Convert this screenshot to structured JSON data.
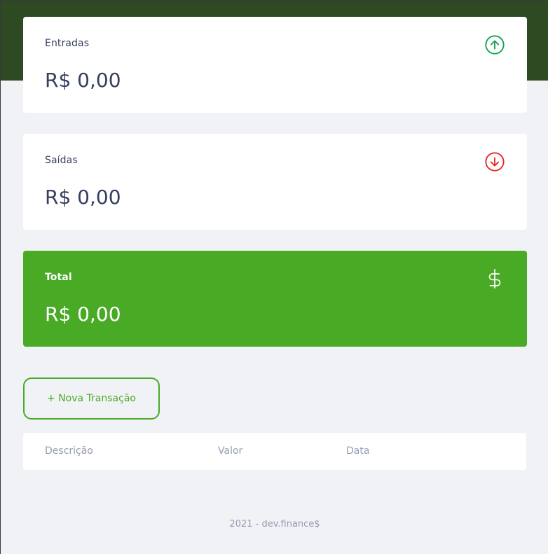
{
  "colors": {
    "header_bg": "#2d4a22",
    "page_bg": "#f0f2f5",
    "card_bg": "#ffffff",
    "total_bg": "#49aa26",
    "income_icon": "#12a454",
    "expense_icon": "#e92929",
    "text": "#363f5f",
    "muted_text": "#969cb3"
  },
  "cards": {
    "income": {
      "label": "Entradas",
      "value": "R$ 0,00",
      "icon": "arrow-up-circle-icon"
    },
    "expense": {
      "label": "Saídas",
      "value": "R$ 0,00",
      "icon": "arrow-down-circle-icon"
    },
    "total": {
      "label": "Total",
      "value": "R$ 0,00",
      "icon": "dollar-sign-icon"
    }
  },
  "actions": {
    "new_transaction": "+ Nova Transação"
  },
  "table": {
    "headers": [
      "Descrição",
      "Valor",
      "Data"
    ]
  },
  "footer": {
    "text": "2021 - dev.finance$"
  }
}
